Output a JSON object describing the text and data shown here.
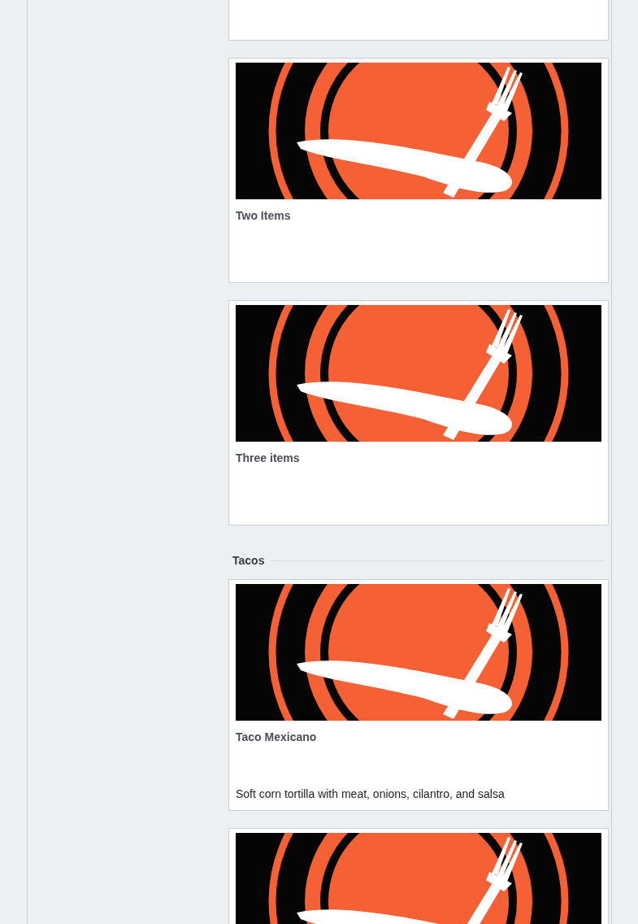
{
  "items": [
    {
      "kind": "picture",
      "title": "Two Items"
    },
    {
      "kind": "picture",
      "title": "Three items"
    }
  ],
  "sections": [
    {
      "heading": "Tacos",
      "items": [
        {
          "kind": "picture",
          "title": "Taco Mexicano",
          "description": "Soft corn tortilla with meat, onions, cilantro, and salsa"
        },
        {
          "kind": "picture"
        }
      ]
    }
  ]
}
